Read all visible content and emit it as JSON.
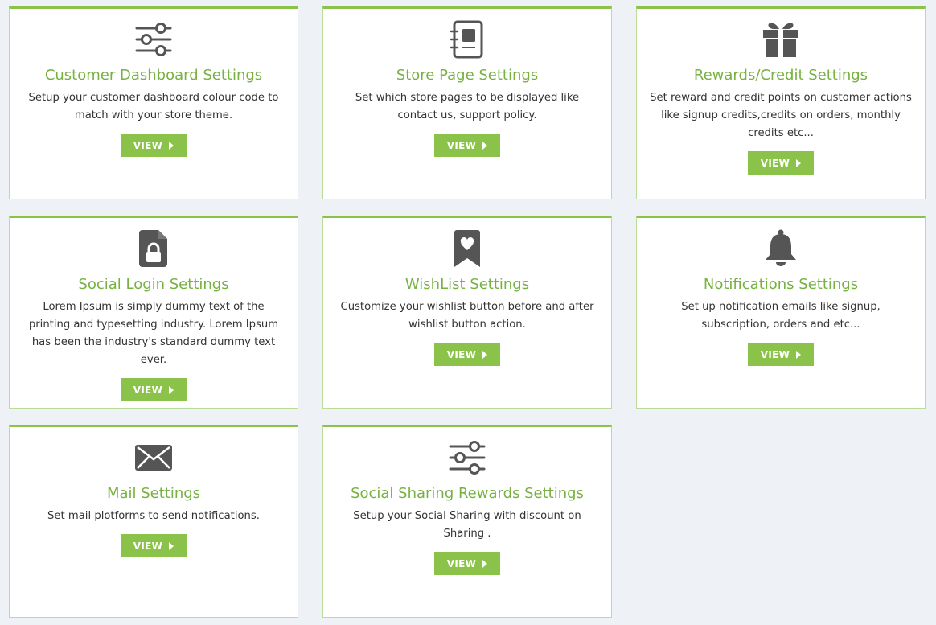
{
  "colors": {
    "accent": "#8bc34a",
    "title": "#77b142",
    "icon": "#555555",
    "background": "#eef1f5"
  },
  "cards": [
    {
      "icon": "sliders-icon",
      "title": "Customer Dashboard Settings",
      "description": "Setup your customer dashboard colour code to match with your store theme.",
      "button_label": "VIEW"
    },
    {
      "icon": "notebook-icon",
      "title": "Store Page Settings",
      "description": "Set which store pages to be displayed like contact us, support policy.",
      "button_label": "VIEW"
    },
    {
      "icon": "gift-icon",
      "title": "Rewards/Credit Settings",
      "description": "Set reward and credit points on customer actions like signup credits,credits on orders, monthly credits etc...",
      "button_label": "VIEW"
    },
    {
      "icon": "file-lock-icon",
      "title": "Social Login Settings",
      "description": "Lorem Ipsum is simply dummy text of the printing and typesetting industry. Lorem Ipsum has been the industry's standard dummy text ever.",
      "button_label": "VIEW"
    },
    {
      "icon": "bookmark-heart-icon",
      "title": "WishList Settings",
      "description": "Customize your wishlist button before and after wishlist button action.",
      "button_label": "VIEW"
    },
    {
      "icon": "bell-icon",
      "title": "Notifications Settings",
      "description": "Set up notification emails like signup, subscription, orders and etc...",
      "button_label": "VIEW"
    },
    {
      "icon": "envelope-icon",
      "title": "Mail Settings",
      "description": "Set mail plotforms to send notifications.",
      "button_label": "VIEW"
    },
    {
      "icon": "sliders-icon",
      "title": "Social Sharing Rewards Settings",
      "description": "Setup your Social Sharing with discount on Sharing .",
      "button_label": "VIEW"
    }
  ]
}
